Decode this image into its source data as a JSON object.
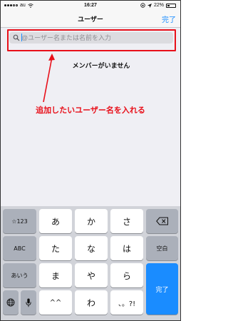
{
  "status_bar": {
    "carrier": "au",
    "time": "16:27",
    "battery": "22%"
  },
  "nav": {
    "title": "ユーザー",
    "done": "完了"
  },
  "search": {
    "placeholder": "@ユーザー名または名前を入力"
  },
  "content": {
    "empty_message": "メンバーがいません",
    "annotation": "追加したいユーザー名を入れる"
  },
  "keyboard": {
    "row1": [
      "☆123",
      "あ",
      "か",
      "さ"
    ],
    "row2": [
      "ABC",
      "た",
      "な",
      "は",
      "空白"
    ],
    "row3": [
      "あいう",
      "ま",
      "や",
      "ら"
    ],
    "row4": [
      "^^",
      "わ",
      "、。?!"
    ],
    "done": "完了",
    "icons": [
      "backspace-icon",
      "globe-icon",
      "microphone-icon"
    ]
  },
  "colors": {
    "accent": "#1a8cff",
    "annotation": "#e8101a"
  }
}
